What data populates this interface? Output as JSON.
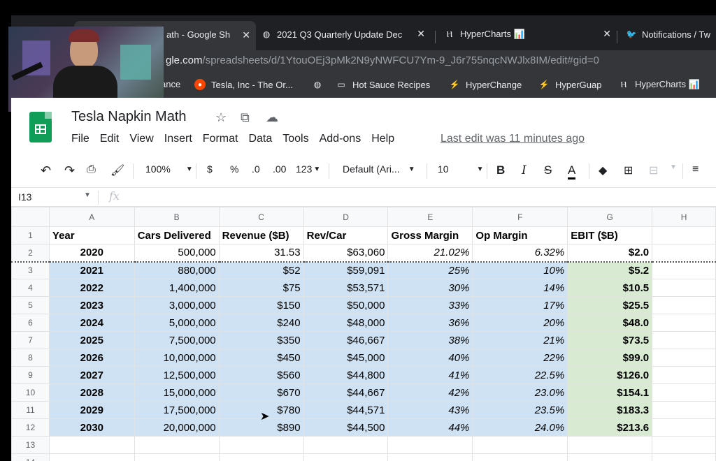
{
  "tabs": [
    {
      "label": "ath - Google Sh",
      "icon": "sheets-icon",
      "close": "✕"
    },
    {
      "label": "2021 Q3 Quarterly Update Dec",
      "icon": "globe-icon",
      "close": "✕"
    },
    {
      "label": "HyperCharts 📊",
      "icon": "hypercharts-icon",
      "close": "✕"
    },
    {
      "label": "Notifications / Tw",
      "icon": "twitter-icon"
    }
  ],
  "url": {
    "host": "gle.com",
    "path": "/spreadsheets/d/1YtouOEj3pMk2N9yNWFCU7Ym-9_J6r755nqcNWJlx8IM/edit#gid=0"
  },
  "bookmarks": [
    {
      "label": "ance",
      "icon": ""
    },
    {
      "label": "Tesla, Inc - The Or...",
      "icon": "reddit-icon"
    },
    {
      "label": "",
      "icon": "globe-icon"
    },
    {
      "label": "Hot Sauce Recipes",
      "icon": "folder-icon"
    },
    {
      "label": "HyperChange",
      "icon": "bolt-icon"
    },
    {
      "label": "HyperGuap",
      "icon": "bolt-icon"
    },
    {
      "label": "HyperCharts 📊",
      "icon": "hypercharts-icon"
    }
  ],
  "doc": {
    "title": "Tesla Napkin Math",
    "menu": [
      "File",
      "Edit",
      "View",
      "Insert",
      "Format",
      "Data",
      "Tools",
      "Add-ons",
      "Help"
    ],
    "last_edit": "Last edit was 11 minutes ago"
  },
  "toolbar": {
    "zoom": "100%",
    "currency": "$",
    "percent": "%",
    "dec_less": ".0",
    "dec_more": ".00",
    "format_more": "123",
    "font": "Default (Ari...",
    "font_size": "10",
    "bold": "B",
    "italic": "I",
    "strike": "S",
    "textcolor": "A"
  },
  "formula_bar": {
    "cell": "I13",
    "fx": "fx",
    "value": ""
  },
  "columns": [
    "A",
    "B",
    "C",
    "D",
    "E",
    "F",
    "G",
    "H"
  ],
  "header_row": [
    "Year",
    "Cars Delivered",
    "Revenue ($B)",
    "Rev/Car",
    "Gross Margin",
    "Op Margin",
    "EBIT ($B)",
    ""
  ],
  "rows": [
    {
      "n": "2",
      "cells": [
        "2020",
        "500,000",
        "31.53",
        "$63,060",
        "21.02%",
        "6.32%",
        "$2.0",
        ""
      ]
    },
    {
      "n": "3",
      "cells": [
        "2021",
        "880,000",
        "$52",
        "$59,091",
        "25%",
        "10%",
        "$5.2",
        ""
      ]
    },
    {
      "n": "4",
      "cells": [
        "2022",
        "1,400,000",
        "$75",
        "$53,571",
        "30%",
        "14%",
        "$10.5",
        ""
      ]
    },
    {
      "n": "5",
      "cells": [
        "2023",
        "3,000,000",
        "$150",
        "$50,000",
        "33%",
        "17%",
        "$25.5",
        ""
      ]
    },
    {
      "n": "6",
      "cells": [
        "2024",
        "5,000,000",
        "$240",
        "$48,000",
        "36%",
        "20%",
        "$48.0",
        ""
      ]
    },
    {
      "n": "7",
      "cells": [
        "2025",
        "7,500,000",
        "$350",
        "$46,667",
        "38%",
        "21%",
        "$73.5",
        ""
      ]
    },
    {
      "n": "8",
      "cells": [
        "2026",
        "10,000,000",
        "$450",
        "$45,000",
        "40%",
        "22%",
        "$99.0",
        ""
      ]
    },
    {
      "n": "9",
      "cells": [
        "2027",
        "12,500,000",
        "$560",
        "$44,800",
        "41%",
        "22.5%",
        "$126.0",
        ""
      ]
    },
    {
      "n": "10",
      "cells": [
        "2028",
        "15,000,000",
        "$670",
        "$44,667",
        "42%",
        "23.0%",
        "$154.1",
        ""
      ]
    },
    {
      "n": "11",
      "cells": [
        "2029",
        "17,500,000",
        "$780",
        "$44,571",
        "43%",
        "23.5%",
        "$183.3",
        ""
      ]
    },
    {
      "n": "12",
      "cells": [
        "2030",
        "20,000,000",
        "$890",
        "$44,500",
        "44%",
        "24.0%",
        "$213.6",
        ""
      ]
    }
  ],
  "row_numbers": {
    "header": "1",
    "empty1": "13",
    "empty2": "14"
  },
  "colors": {
    "header_bg": "#f8f9fa",
    "blue_fill": "#cfe2f3",
    "green_fill": "#d9ead3",
    "sheets_green": "#0f9d58",
    "chrome_dark": "#35363a"
  }
}
